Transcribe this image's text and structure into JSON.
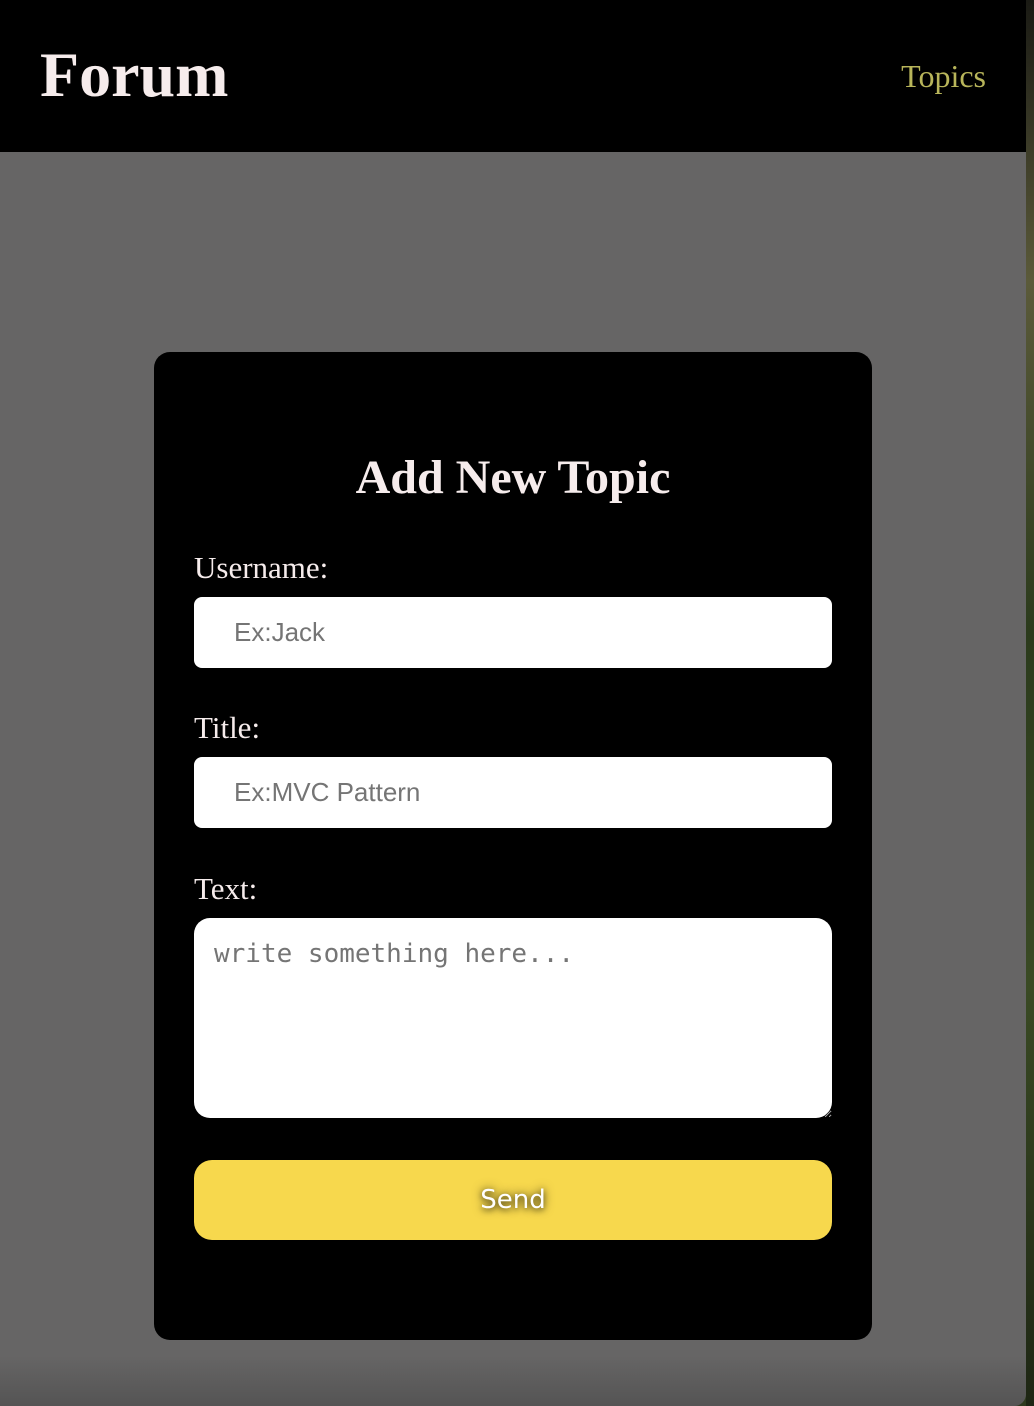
{
  "header": {
    "logo": "Forum",
    "nav_topics": "Topics"
  },
  "form": {
    "title": "Add New Topic",
    "username": {
      "label": "Username:",
      "value": "",
      "placeholder": "Ex:Jack"
    },
    "topic_title": {
      "label": "Title:",
      "value": "",
      "placeholder": "Ex:MVC Pattern"
    },
    "text": {
      "label": "Text:",
      "value": "",
      "placeholder": "write something here..."
    },
    "submit_label": "Send"
  },
  "colors": {
    "header_bg": "#000000",
    "page_bg": "#666565",
    "card_bg": "#000000",
    "nav_link": "#b8b55a",
    "button_bg": "#f7d84d",
    "heading_text": "#f6ecec"
  }
}
